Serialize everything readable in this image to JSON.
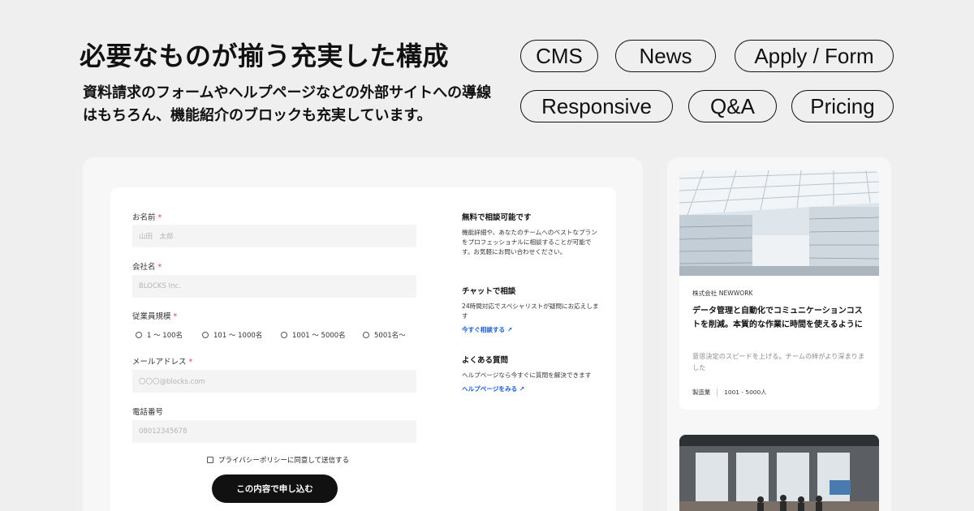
{
  "hero": {
    "title": "必要なものが揃う充実した構成",
    "description": "資料請求のフォームやヘルプページなどの外部サイトへの導線はもちろん、機能紹介のブロックも充実しています。"
  },
  "tags": [
    "CMS",
    "News",
    "Apply / Form",
    "Responsive",
    "Q&A",
    "Pricing"
  ],
  "form": {
    "name_label": "お名前",
    "name_placeholder": "山田　太郎",
    "company_label": "会社名",
    "company_placeholder": "BLOCKS Inc.",
    "size_label": "従業員規模",
    "size_options": [
      "1 〜 100名",
      "101 〜 1000名",
      "1001 〜 5000名",
      "5001名〜"
    ],
    "email_label": "メールアドレス",
    "email_placeholder": "〇〇〇@blocks.com",
    "phone_label": "電話番号",
    "phone_placeholder": "08012345678",
    "required_mark": "*",
    "privacy_label": "プライバシーポリシーに同意して送信する",
    "submit_label": "この内容で申し込む"
  },
  "info": [
    {
      "title": "無料で相談可能です",
      "text": "機能詳細や、あなたのチームへのベストなプランをプロフェッショナルに相談することが可能です。お気軽にお問い合わせください。",
      "link": ""
    },
    {
      "title": "チャットで相談",
      "text": "24時間対応でスペシャリストが疑問にお応えします",
      "link": "今すぐ相談する ↗"
    },
    {
      "title": "よくある質問",
      "text": "ヘルプページなら今すぐに質問を解決できます",
      "link": "ヘルプページをみる ↗"
    }
  ],
  "case": {
    "company": "株式会社 NEWWORK",
    "title": "データ管理と自動化でコミュニケーションコストを削減。本質的な作業に時間を使えるように",
    "description": "意思決定のスピードを上げる。チームの絆がより深まりました",
    "industry": "製造業",
    "size": "1001 - 5000人"
  },
  "colors": {
    "background": "#efefef",
    "accent_link": "#1d5fd1",
    "required": "#e0434b",
    "button": "#111111"
  }
}
